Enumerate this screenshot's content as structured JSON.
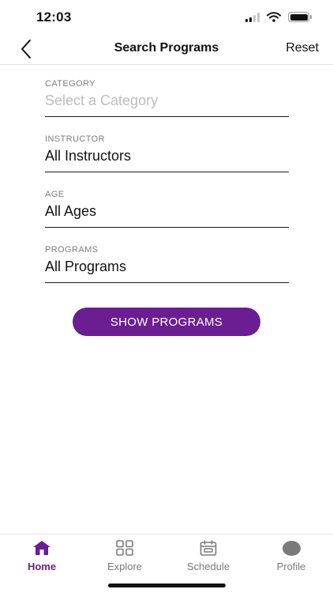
{
  "status_bar": {
    "time": "12:03",
    "icons": [
      "signal-icon",
      "wifi-icon",
      "battery-icon"
    ]
  },
  "nav": {
    "back_icon": "chevron-left-icon",
    "title": "Search Programs",
    "reset_label": "Reset"
  },
  "form": {
    "fields": [
      {
        "label": "CATEGORY",
        "value": "",
        "placeholder": "Select a Category"
      },
      {
        "label": "INSTRUCTOR",
        "value": "All Instructors"
      },
      {
        "label": "AGE",
        "value": "All Ages"
      },
      {
        "label": "PROGRAMS",
        "value": "All Programs"
      }
    ]
  },
  "show_button": {
    "label": "SHOW PROGRAMS"
  },
  "tab_bar": {
    "items": [
      {
        "label": "Home",
        "icon": "home-icon",
        "active": true
      },
      {
        "label": "Explore",
        "icon": "grid-icon",
        "active": false
      },
      {
        "label": "Schedule",
        "icon": "calendar-icon",
        "active": false
      },
      {
        "label": "Profile",
        "icon": "avatar-icon",
        "active": false
      }
    ]
  },
  "colors": {
    "accent": "#6a1e91",
    "inactive": "#7a7a7a",
    "placeholder": "#bdbdbd",
    "label": "#7d7d7d"
  }
}
